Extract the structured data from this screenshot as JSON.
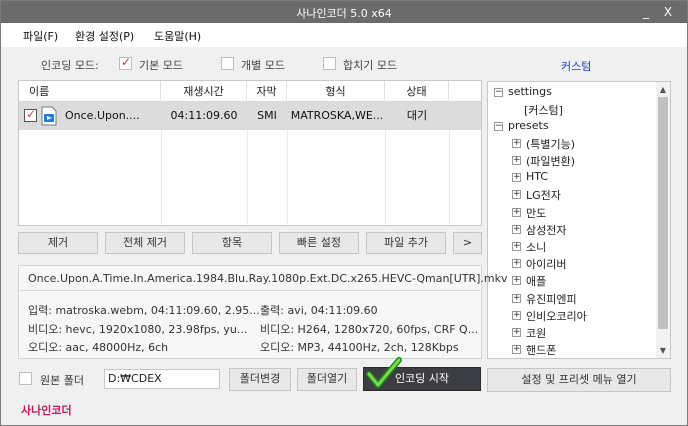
{
  "window": {
    "title": "사나인코더  5.0 x64",
    "controls": {
      "minimize": "_",
      "close": "X"
    }
  },
  "menu": [
    "파일(F)",
    "환경 설정(P)",
    "도움말(H)"
  ],
  "encoding_modes": {
    "label": "인코딩 모드:",
    "options": [
      {
        "label": "기본 모드",
        "checked": true
      },
      {
        "label": "개별 모드",
        "checked": false
      },
      {
        "label": "합치기 모드",
        "checked": false
      }
    ],
    "custom_link": "커스텀"
  },
  "file_list": {
    "columns": [
      "이름",
      "재생시간",
      "자막",
      "형식",
      "상태"
    ],
    "rows": [
      {
        "checked": true,
        "name": "Once.Upon....",
        "duration": "04:11:09.60",
        "subtitle": "SMI",
        "format": "MATROSKA,WE...",
        "status": "대기"
      }
    ]
  },
  "action_buttons": [
    "제거",
    "전체 제거",
    "항목",
    "빠른 설정",
    "파일 추가",
    ">"
  ],
  "tree": {
    "nodes": [
      {
        "label": "settings",
        "level": 0,
        "expander": "−"
      },
      {
        "label": "[커스텀]",
        "level": 1,
        "expander": ""
      },
      {
        "label": "presets",
        "level": 0,
        "expander": "−"
      },
      {
        "label": "(특별기능)",
        "level": 1,
        "expander": "+"
      },
      {
        "label": "(파일변환)",
        "level": 1,
        "expander": "+"
      },
      {
        "label": "HTC",
        "level": 1,
        "expander": "+"
      },
      {
        "label": "LG전자",
        "level": 1,
        "expander": "+"
      },
      {
        "label": "만도",
        "level": 1,
        "expander": "+"
      },
      {
        "label": "삼성전자",
        "level": 1,
        "expander": "+"
      },
      {
        "label": "소니",
        "level": 1,
        "expander": "+"
      },
      {
        "label": "아이리버",
        "level": 1,
        "expander": "+"
      },
      {
        "label": "애플",
        "level": 1,
        "expander": "+"
      },
      {
        "label": "유진피엔피",
        "level": 1,
        "expander": "+"
      },
      {
        "label": "인비오코리아",
        "level": 1,
        "expander": "+"
      },
      {
        "label": "코원",
        "level": 1,
        "expander": "+"
      },
      {
        "label": "핸드폰",
        "level": 1,
        "expander": "+"
      }
    ]
  },
  "info": {
    "filename": "Once.Upon.A.Time.In.America.1984.Blu.Ray.1080p.Ext.DC.x265.HEVC-Qman[UTR].mkv",
    "input": "입력: matroska.webm, 04:11:09.60, 2.95...",
    "video_in": "비디오: hevc, 1920x1080, 23.98fps,   yu...",
    "audio_in": "오디오: aac, 48000Hz, 6ch",
    "output": "출력: avi, 04:11:09.60",
    "video_out": "비디오: H264, 1280x720, 60fps, CRF Q...",
    "audio_out": "오디오: MP3, 44100Hz, 2ch, 128Kbps"
  },
  "bottom": {
    "source_folder_label": "원본 폴더",
    "folder_path": "D:₩CDEX",
    "change_folder": "폴더변경",
    "open_folder": "폴더열기",
    "start_encoding": "인코딩 시작",
    "preset_menu": "설정 및 프리셋 메뉴 열기"
  },
  "footer": {
    "brand": "사나인코더"
  },
  "colors": {
    "titlebar": "#6b6b6b",
    "link": "#1d3fcf",
    "brand": "#c0185f",
    "start_button": "#3c3e44",
    "selected_row": "#dcdcdc"
  }
}
